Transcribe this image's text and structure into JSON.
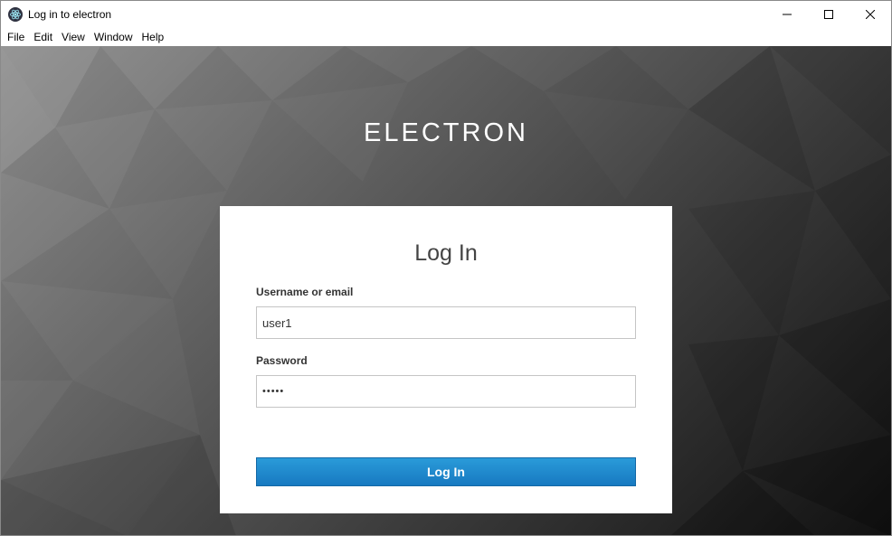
{
  "window": {
    "title": "Log in to electron"
  },
  "menu": [
    "File",
    "Edit",
    "View",
    "Window",
    "Help"
  ],
  "brand": "ELECTRON",
  "login": {
    "heading": "Log In",
    "username_label": "Username or email",
    "username_value": "user1",
    "password_label": "Password",
    "password_value": "•••••",
    "submit_label": "Log In"
  },
  "colors": {
    "button": "#1a86cc",
    "background_dark": "#111111",
    "background_light": "#8a8a8a"
  }
}
